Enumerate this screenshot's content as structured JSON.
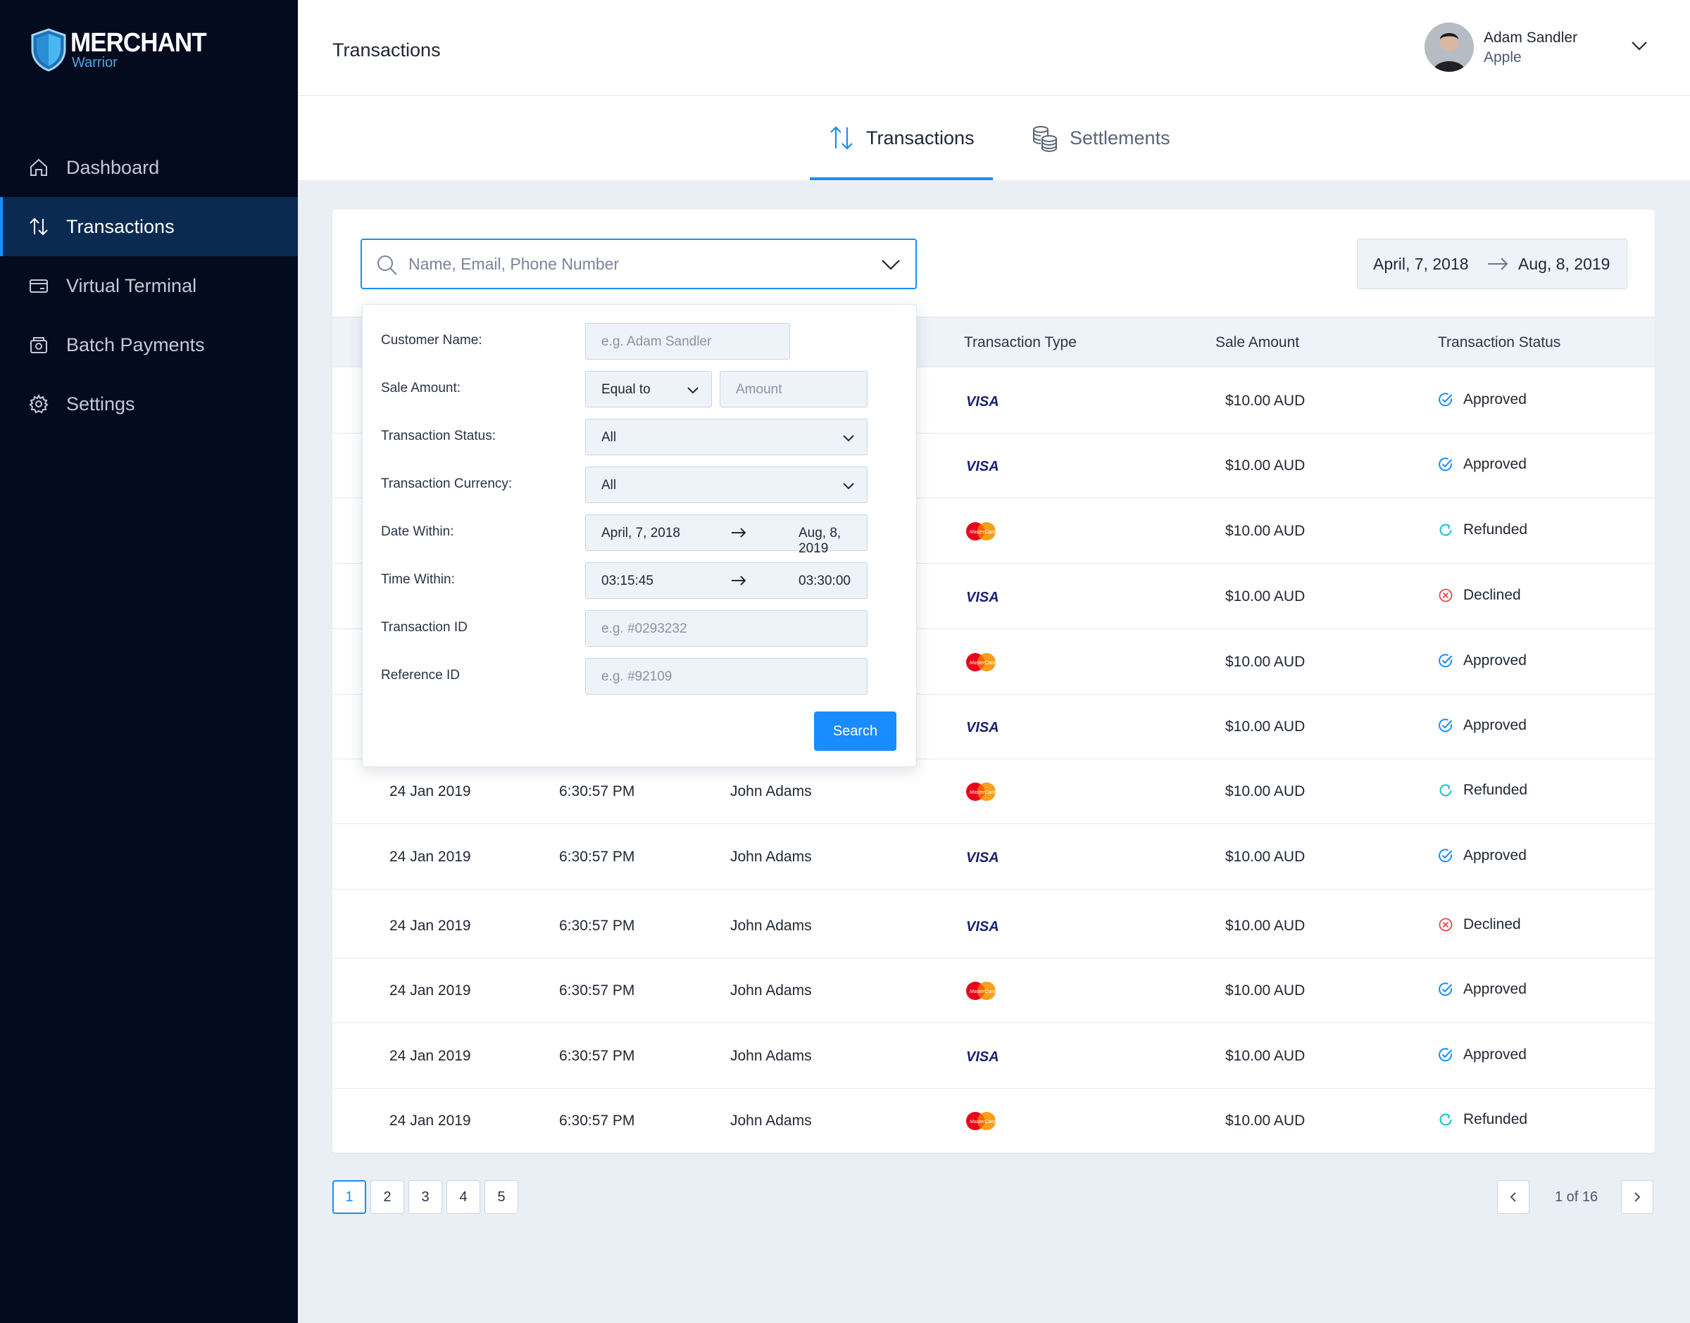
{
  "brand": {
    "name": "MERCHANT",
    "sub": "Warrior"
  },
  "sidebar": {
    "items": [
      {
        "label": "Dashboard",
        "icon": "home-icon",
        "active": false
      },
      {
        "label": "Transactions",
        "icon": "arrows-up-down-icon",
        "active": true
      },
      {
        "label": "Virtual Terminal",
        "icon": "card-terminal-icon",
        "active": false
      },
      {
        "label": "Batch Payments",
        "icon": "batch-icon",
        "active": false
      },
      {
        "label": "Settings",
        "icon": "gear-icon",
        "active": false
      }
    ]
  },
  "header": {
    "title": "Transactions",
    "user": {
      "name": "Adam Sandler",
      "org": "Apple"
    }
  },
  "tabs": [
    {
      "label": "Transactions",
      "icon": "arrows-up-down-icon",
      "active": true
    },
    {
      "label": "Settlements",
      "icon": "coins-icon",
      "active": false
    }
  ],
  "search": {
    "placeholder": "Name, Email, Phone Number",
    "value": ""
  },
  "date_range": {
    "from": "April, 7, 2018",
    "to": "Aug, 8, 2019"
  },
  "table": {
    "columns": [
      "Transaction Type",
      "Sale Amount",
      "Transaction Status"
    ],
    "rows": [
      {
        "date": "",
        "time": "",
        "name": "",
        "type": "VISA",
        "amount": "$10.00 AUD",
        "status": "Approved"
      },
      {
        "date": "",
        "time": "",
        "name": "",
        "type": "VISA",
        "amount": "$10.00 AUD",
        "status": "Approved"
      },
      {
        "date": "",
        "time": "",
        "name": "",
        "type": "MasterCard",
        "amount": "$10.00 AUD",
        "status": "Refunded"
      },
      {
        "date": "",
        "time": "",
        "name": "",
        "type": "VISA",
        "amount": "$10.00 AUD",
        "status": "Declined"
      },
      {
        "date": "",
        "time": "",
        "name": "",
        "type": "MasterCard",
        "amount": "$10.00 AUD",
        "status": "Approved"
      },
      {
        "date": "",
        "time": "",
        "name": "",
        "type": "VISA",
        "amount": "$10.00 AUD",
        "status": "Approved"
      },
      {
        "date": "24 Jan 2019",
        "time": "6:30:57 PM",
        "name": "John Adams",
        "type": "MasterCard",
        "amount": "$10.00 AUD",
        "status": "Refunded"
      },
      {
        "date": "24 Jan 2019",
        "time": "6:30:57 PM",
        "name": "John Adams",
        "type": "VISA",
        "amount": "$10.00 AUD",
        "status": "Approved"
      },
      {
        "date": "24 Jan 2019",
        "time": "6:30:57 PM",
        "name": "John Adams",
        "type": "VISA",
        "amount": "$10.00 AUD",
        "status": "Declined"
      },
      {
        "date": "24 Jan 2019",
        "time": "6:30:57 PM",
        "name": "John Adams",
        "type": "MasterCard",
        "amount": "$10.00 AUD",
        "status": "Approved"
      },
      {
        "date": "24 Jan 2019",
        "time": "6:30:57 PM",
        "name": "John Adams",
        "type": "VISA",
        "amount": "$10.00 AUD",
        "status": "Approved"
      },
      {
        "date": "24 Jan 2019",
        "time": "6:30:57 PM",
        "name": "John Adams",
        "type": "MasterCard",
        "amount": "$10.00 AUD",
        "status": "Refunded"
      }
    ]
  },
  "filter": {
    "customer_name": {
      "label": "Customer Name:",
      "placeholder": "e.g. Adam Sandler"
    },
    "sale_amount": {
      "label": "Sale Amount:",
      "operator": "Equal to",
      "placeholder": "Amount"
    },
    "status": {
      "label": "Transaction Status:",
      "value": "All"
    },
    "currency": {
      "label": "Transaction Currency:",
      "value": "All"
    },
    "date_within": {
      "label": "Date Within:",
      "from": "April, 7, 2018",
      "to": "Aug, 8, 2019"
    },
    "time_within": {
      "label": "Time Within:",
      "from": "03:15:45",
      "to": "03:30:00"
    },
    "transaction_id": {
      "label": "Transaction ID",
      "placeholder": "e.g. #0293232"
    },
    "reference_id": {
      "label": "Reference ID",
      "placeholder": "e.g. #92109"
    },
    "search_label": "Search"
  },
  "pagination": {
    "pages": [
      "1",
      "2",
      "3",
      "4",
      "5"
    ],
    "current": "1",
    "info": "1 of 16"
  },
  "colors": {
    "sidebar_bg": "#050b1f",
    "sidebar_active": "#0b2a52",
    "accent": "#1a8cff",
    "approved": "#1a8cff",
    "refunded": "#17c1d6",
    "declined": "#e5484d"
  }
}
